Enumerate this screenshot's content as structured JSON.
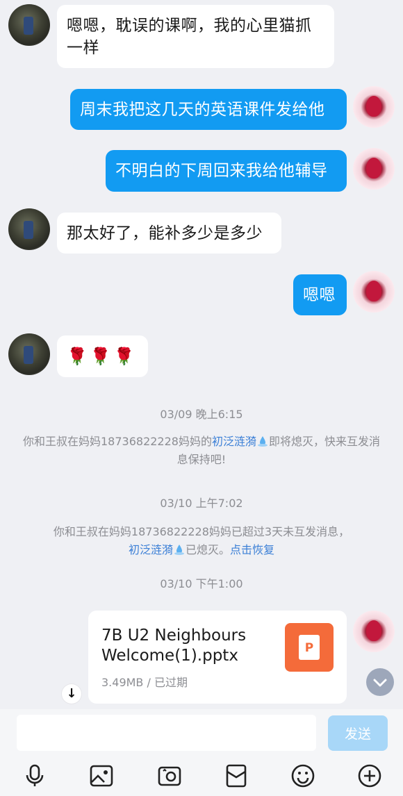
{
  "messages": [
    {
      "side": "in",
      "text": "嗯嗯，耽误的课啊，我的心里猫抓一样"
    },
    {
      "side": "out",
      "text": "周末我把这几天的英语课件发给他"
    },
    {
      "side": "out",
      "text": "不明白的下周回来我给他辅导"
    },
    {
      "side": "in",
      "text": "那太好了，能补多少是多少"
    },
    {
      "side": "out",
      "text": "嗯嗯"
    },
    {
      "side": "in",
      "text": "🌹🌹🌹"
    }
  ],
  "system": {
    "time1": "03/09 晚上6:15",
    "notice1_prefix": "你和王叔在妈妈18736822228妈妈的",
    "spark_name": "初泛涟漪",
    "notice1_suffix": "即将熄灭，快来互发消息保持吧!",
    "time2": "03/10 上午7:02",
    "notice2_line1": "你和王叔在妈妈18736822228妈妈已超过3天未互发消息，",
    "notice2_after": "已熄灭。",
    "restore_link": "点击恢复",
    "time3": "03/10 下午1:00"
  },
  "file": {
    "name": "7B U2 Neighbours Welcome(1).pptx",
    "meta": "3.49MB / 已过期",
    "icon_letter": "P",
    "icon_color": "#f46b3a"
  },
  "input": {
    "placeholder": "",
    "send_label": "发送"
  },
  "toolbar": [
    "microphone-icon",
    "image-icon",
    "camera-icon",
    "red-packet-icon",
    "emoji-icon",
    "plus-icon"
  ],
  "colors": {
    "outgoing_bubble": "#129bf2",
    "background": "#eff0f4",
    "link": "#3b7fd6"
  }
}
